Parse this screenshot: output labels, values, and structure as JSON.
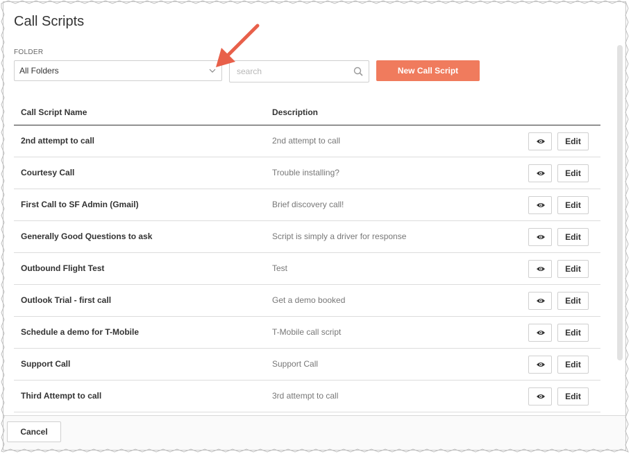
{
  "page": {
    "title": "Call Scripts"
  },
  "folder": {
    "label": "FOLDER",
    "selected": "All Folders"
  },
  "search": {
    "placeholder": "search"
  },
  "toolbar": {
    "new_label": "New Call Script"
  },
  "table": {
    "columns": [
      "Call Script Name",
      "Description"
    ],
    "edit_label": "Edit",
    "rows": [
      {
        "name": "2nd attempt to call",
        "description": "2nd attempt to call"
      },
      {
        "name": "Courtesy Call",
        "description": "Trouble installing?"
      },
      {
        "name": "First Call to SF Admin (Gmail)",
        "description": "Brief discovery call!"
      },
      {
        "name": "Generally Good Questions to ask",
        "description": "Script is simply a driver for response"
      },
      {
        "name": "Outbound Flight Test",
        "description": "Test"
      },
      {
        "name": "Outlook Trial - first call",
        "description": "Get a demo booked"
      },
      {
        "name": "Schedule a demo for T-Mobile",
        "description": "T-Mobile call script"
      },
      {
        "name": "Support Call",
        "description": "Support Call"
      },
      {
        "name": "Third Attempt to call",
        "description": "3rd attempt to call"
      }
    ]
  },
  "footer": {
    "cancel_label": "Cancel"
  },
  "colors": {
    "accent": "#f07b5d",
    "arrow": "#e8604a"
  }
}
